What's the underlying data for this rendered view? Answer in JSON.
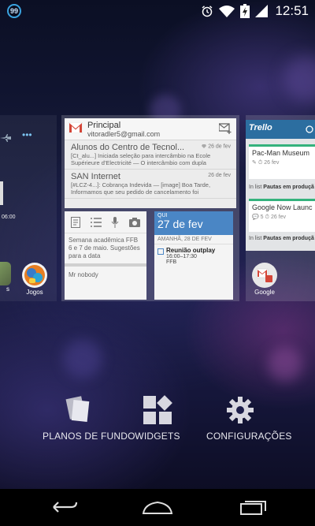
{
  "status_bar": {
    "notification_count": "99",
    "time": "12:51",
    "icons": [
      "alarm-icon",
      "wifi-icon",
      "battery-icon",
      "signal-icon"
    ]
  },
  "gmail_widget": {
    "label": "Principal",
    "account": "vitoradler5@gmail.com",
    "messages": [
      {
        "from": "Alunos do Centro de Tecnol...",
        "date": "26 de fev",
        "snippet1": "[Ct_alu...] Iniciada seleção para intercâmbio na Ecole",
        "snippet2": "Supérieure d'Electricité — O intercâmbio com dupla"
      },
      {
        "from": "SAN Internet",
        "date": "26 de fev",
        "snippet1": "[#LCZ-4...]: Cobrança Indevida — [image] Boa Tarde,",
        "snippet2": "Informamos que seu pedido de cancelamento foi"
      }
    ]
  },
  "keep_widget": {
    "note1": "Semana acadêmica FFB 6 e 7 de maio. Sugestões para a data",
    "note2": "Mr nobody"
  },
  "calendar_widget": {
    "day_of_week": "QUI",
    "date": "27 de fev",
    "next_day": "AMANHÃ, 28 DE FEV",
    "event_title": "Reunião outplay",
    "event_time": "16:00–17:30",
    "event_location": "FFB"
  },
  "trello_widget": {
    "logo": "Trello",
    "card1_title": "Pac-Man Museum",
    "card1_date": "26 fev",
    "card1_list_prefix": "In list",
    "card1_list": "Pautas em produçã",
    "card2_title": "Google Now Launc",
    "card2_comments": "5",
    "card2_date": "26 fev",
    "card2_list_prefix": "In list",
    "card2_list": "Pautas em produçã"
  },
  "left_panel": {
    "time_fragment": "06:00",
    "app_partial_label": "s"
  },
  "apps": {
    "jogos": "Jogos",
    "google": "Google"
  },
  "overview_options": {
    "wallpapers": "PLANOS DE FUNDO",
    "widgets": "WIDGETS",
    "settings": "CONFIGURAÇÕES"
  },
  "colors": {
    "accent_blue": "#4a86c5",
    "trello_blue": "#2c6ea0",
    "trello_green": "#34b27d",
    "notif_ring": "#3aa3e0"
  }
}
